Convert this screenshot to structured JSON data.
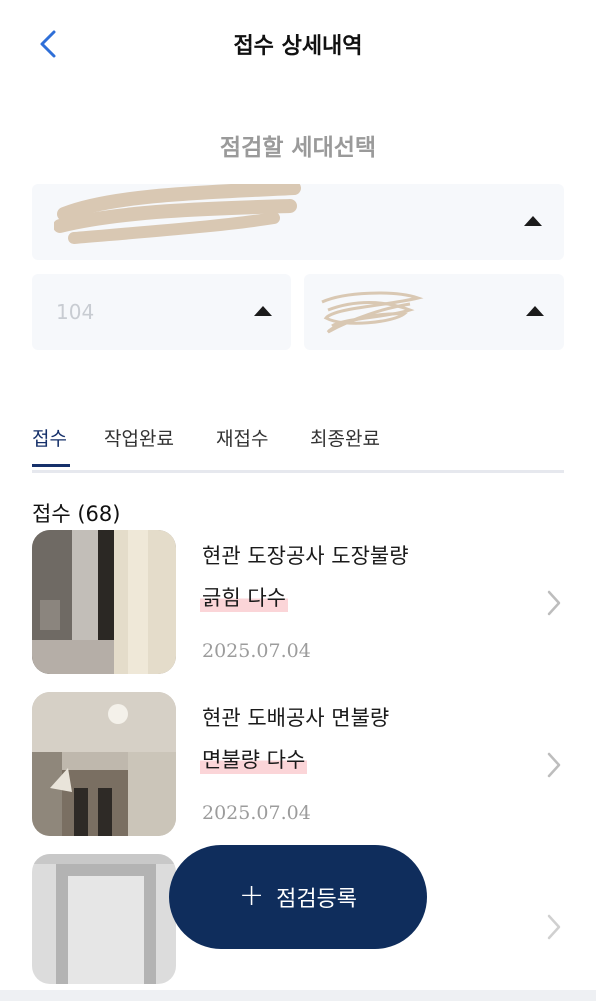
{
  "header": {
    "title": "접수 상세내역",
    "back_icon": "chevron-left-icon",
    "accent": "#2f6fd8"
  },
  "unit_select": {
    "label": "점검할 세대선택",
    "building_value": "104"
  },
  "tabs": [
    {
      "label": "접수",
      "active": true
    },
    {
      "label": "작업완료",
      "active": false
    },
    {
      "label": "재접수",
      "active": false
    },
    {
      "label": "최종완료",
      "active": false
    }
  ],
  "list": {
    "count_label": "접수 (68)",
    "items": [
      {
        "title": "현관 도장공사 도장불량",
        "detail": "긁힘 다수",
        "date": "2025.07.04"
      },
      {
        "title": "현관 도배공사 면불량",
        "detail": "면불량 다수",
        "date": "2025.07.04"
      }
    ]
  },
  "fab": {
    "plus": "+",
    "label": "점검등록",
    "color": "#0f2d5c"
  }
}
